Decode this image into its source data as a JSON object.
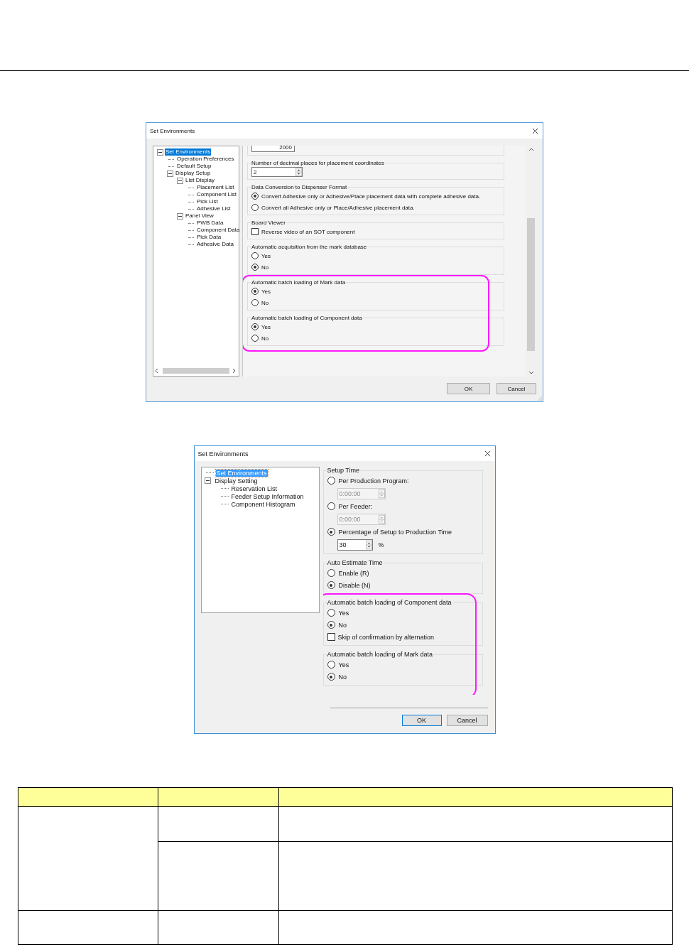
{
  "dialogs": [
    {
      "title": "Set Environments",
      "tree": [
        {
          "label": "Set Environments",
          "selected": true,
          "expanded": true,
          "children": [
            {
              "label": "Operation Preferences",
              "selected": false
            },
            {
              "label": "Default Setup",
              "selected": false
            },
            {
              "label": "Display Setup",
              "selected": false,
              "expanded": true,
              "children": [
                {
                  "label": "List Display",
                  "selected": false,
                  "expanded": true,
                  "children": [
                    {
                      "label": "Placement List",
                      "selected": false
                    },
                    {
                      "label": "Component List",
                      "selected": false
                    },
                    {
                      "label": "Pick List",
                      "selected": false
                    },
                    {
                      "label": "Adhesive List",
                      "selected": false
                    }
                  ]
                },
                {
                  "label": "Panel View",
                  "selected": false,
                  "expanded": true,
                  "children": [
                    {
                      "label": "PWB Data",
                      "selected": false
                    },
                    {
                      "label": "Component Data",
                      "selected": false
                    },
                    {
                      "label": "Pick Data",
                      "selected": false
                    },
                    {
                      "label": "Adhesive Data",
                      "selected": false
                    }
                  ]
                }
              ]
            }
          ]
        }
      ],
      "sections": [
        {
          "highlighted": false,
          "items": [
            {
              "kind": "field",
              "value": "2000"
            }
          ]
        },
        {
          "title": "Number of decimal places for placement coordinates",
          "highlighted": false,
          "items": [
            {
              "kind": "spinner",
              "value": "2",
              "disabled": false
            }
          ]
        },
        {
          "title": "Data Conversion to Dispenser Format",
          "highlighted": false,
          "items": [
            {
              "kind": "radio",
              "label": "Convert Adhesive only or Adhesive/Place placement data with complete adhesive data.",
              "selected": true
            },
            {
              "kind": "radio",
              "label": "Convert all Adhesive only or Place/Adhesive placement data.",
              "selected": false
            }
          ]
        },
        {
          "title": "Board Viewer",
          "highlighted": false,
          "items": [
            {
              "kind": "checkbox",
              "label": "Reverse video of an SOT component",
              "checked": false
            }
          ]
        },
        {
          "title": "Automatic acquisition from the mark database",
          "highlighted": false,
          "items": [
            {
              "kind": "radio",
              "label": "Yes",
              "selected": false
            },
            {
              "kind": "radio",
              "label": "No",
              "selected": true
            }
          ]
        },
        {
          "title": "Automatic batch loading of Mark data",
          "highlighted": true,
          "items": [
            {
              "kind": "radio",
              "label": "Yes",
              "selected": true
            },
            {
              "kind": "radio",
              "label": "No",
              "selected": false
            }
          ]
        },
        {
          "title": "Automatic batch loading of Component data",
          "highlighted": true,
          "items": [
            {
              "kind": "radio",
              "label": "Yes",
              "selected": true
            },
            {
              "kind": "radio",
              "label": "No",
              "selected": false
            }
          ]
        }
      ],
      "buttons": [
        {
          "label": "OK",
          "default": false
        },
        {
          "label": "Cancel",
          "default": false
        }
      ]
    },
    {
      "title": "Set Environments",
      "tree": [
        {
          "label": "Set Environments",
          "selected": true
        },
        {
          "label": "Display Setting",
          "selected": false,
          "expanded": true,
          "children": [
            {
              "label": "Reservation List",
              "selected": false
            },
            {
              "label": "Feeder Setup Information",
              "selected": false
            },
            {
              "label": "Component Histogram",
              "selected": false
            }
          ]
        }
      ],
      "sections": [
        {
          "title": "Setup Time",
          "highlighted": false,
          "items": [
            {
              "kind": "radio",
              "label": "Per Production Program:",
              "selected": false
            },
            {
              "kind": "spinner",
              "value": "0:00:00",
              "disabled": true
            },
            {
              "kind": "radio",
              "label": "Per Feeder:",
              "selected": false
            },
            {
              "kind": "spinner",
              "value": "0:00:00",
              "disabled": true
            },
            {
              "kind": "radio",
              "label": "Percentage of Setup to Production Time",
              "selected": true
            },
            {
              "kind": "spinner",
              "value": "30",
              "disabled": false,
              "suffix": "%"
            }
          ]
        },
        {
          "title": "Auto Estimate Time",
          "highlighted": false,
          "items": [
            {
              "kind": "radio",
              "label": "Enable (R)",
              "selected": false
            },
            {
              "kind": "radio",
              "label": "Disable (N)",
              "selected": true
            }
          ]
        },
        {
          "title": "Automatic batch loading of Component data",
          "highlighted": true,
          "items": [
            {
              "kind": "radio",
              "label": "Yes",
              "selected": false
            },
            {
              "kind": "radio",
              "label": "No",
              "selected": true
            },
            {
              "kind": "checkbox",
              "label": "Skip of confirmation by alternation",
              "checked": false
            }
          ]
        },
        {
          "title": "Automatic batch loading of Mark data",
          "highlighted": true,
          "items": [
            {
              "kind": "radio",
              "label": "Yes",
              "selected": false
            },
            {
              "kind": "radio",
              "label": "No",
              "selected": true
            }
          ]
        }
      ],
      "buttons": [
        {
          "label": "OK",
          "default": true
        },
        {
          "label": "Cancel",
          "default": false
        }
      ]
    }
  ]
}
